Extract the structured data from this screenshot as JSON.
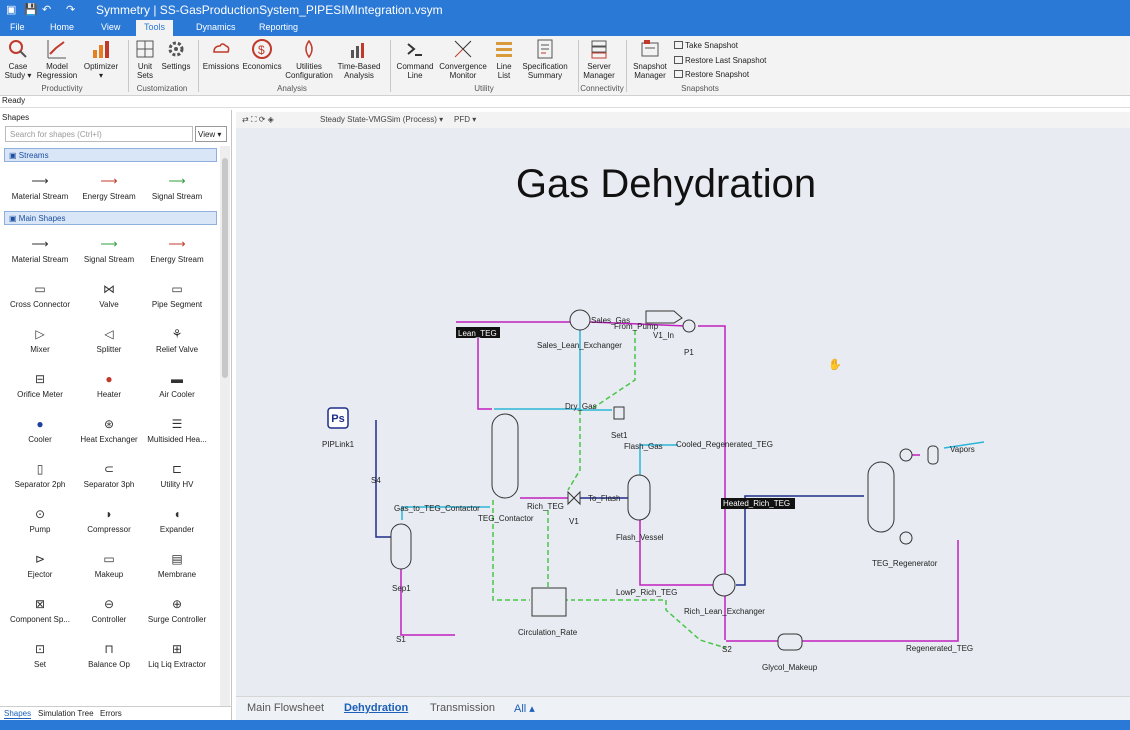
{
  "app": {
    "title": "Symmetry | SS-GasProductionSystem_PIPESIMIntegration.vsym"
  },
  "menu": {
    "tabs": [
      "File",
      "Home",
      "View",
      "Tools",
      "Dynamics",
      "Reporting"
    ]
  },
  "ribbon": {
    "buttons": [
      "Case Study",
      "Model Regression",
      "Optimizer",
      "Unit Sets",
      "Settings",
      "Emissions",
      "Economics",
      "Utilities Configuration",
      "Time-Based Analysis",
      "Command Line",
      "Convergence Monitor",
      "Line List",
      "Specification Summary",
      "Server Manager",
      "Snapshot Manager"
    ],
    "groups": [
      "Productivity",
      "Customization",
      "Analysis",
      "Utility",
      "Connectivity",
      "Snapshots"
    ],
    "snapshots": [
      "Take Snapshot",
      "Restore Last Snapshot",
      "Restore Snapshot"
    ]
  },
  "status": "Ready",
  "shapes_panel": {
    "title": "Shapes",
    "search_placeholder": "Search for shapes (Ctrl+I)",
    "view_label": "View",
    "sections": [
      "Streams",
      "Main Shapes"
    ],
    "streams": [
      "Material Stream",
      "Energy Stream",
      "Signal Stream"
    ],
    "main": [
      "Material Stream",
      "Signal Stream",
      "Energy Stream",
      "Cross Connector",
      "Valve",
      "Pipe Segment",
      "Mixer",
      "Splitter",
      "Relief Valve",
      "Orifice Meter",
      "Heater",
      "Air Cooler",
      "Cooler",
      "Heat Exchanger",
      "Multisided Hea...",
      "Separator 2ph",
      "Separator 3ph",
      "Utility HV",
      "Pump",
      "Compressor",
      "Expander",
      "Ejector",
      "Makeup",
      "Membrane",
      "Component Sp...",
      "Controller",
      "Surge Controller",
      "Set",
      "Balance Op",
      "Liq Liq Extractor"
    ],
    "tabs": [
      "Shapes",
      "Simulation Tree",
      "Errors"
    ]
  },
  "canvas_toolbar": {
    "mode": "Steady State-VMGSim (Process)",
    "view": "PFD"
  },
  "flowsheet": {
    "title": "Gas Dehydration",
    "labels": {
      "lean_teg": "Lean_TEG",
      "sales_gas": "Sales_Gas",
      "from_pump": "From_Pump",
      "v1_in": "V1_In",
      "p1": "P1",
      "sales_lean": "Sales_Lean_Exchanger",
      "dry_gas": "Dry_Gas",
      "set1": "Set1",
      "piplink": "PIPLink1",
      "piplink_ic": "Ps",
      "s4": "S4",
      "flash_gas": "Flash_Gas",
      "cooled": "Cooled_Regenerated_TEG",
      "vapors": "Vapors",
      "gas_to": "Gas_to_TEG_Contactor",
      "rich_teg": "Rich_TEG",
      "to_flash": "To_Flash",
      "v1": "V1",
      "heated_rich": "Heated_Rich_TEG",
      "teg_contactor": "TEG_Contactor",
      "flash_vessel": "Flash_Vessel",
      "teg_regen": "TEG_Regenerator",
      "sep1": "Sep1",
      "lowp": "LowP_Rich_TEG",
      "rich_lean": "Rich_Lean_Exchanger",
      "circ": "Circulation_Rate",
      "s1": "S1",
      "s2": "S2",
      "glycol": "Glycol_Makeup",
      "regen_teg": "Regenerated_TEG"
    }
  },
  "bottom_tabs": [
    "Main Flowsheet",
    "Dehydration",
    "Transmission",
    "All"
  ],
  "colors": {
    "accent": "#2b79d6",
    "material": "#c020c0",
    "cyan": "#2bb5d8",
    "navy": "#1f2d8a",
    "signal": "#49c549"
  }
}
